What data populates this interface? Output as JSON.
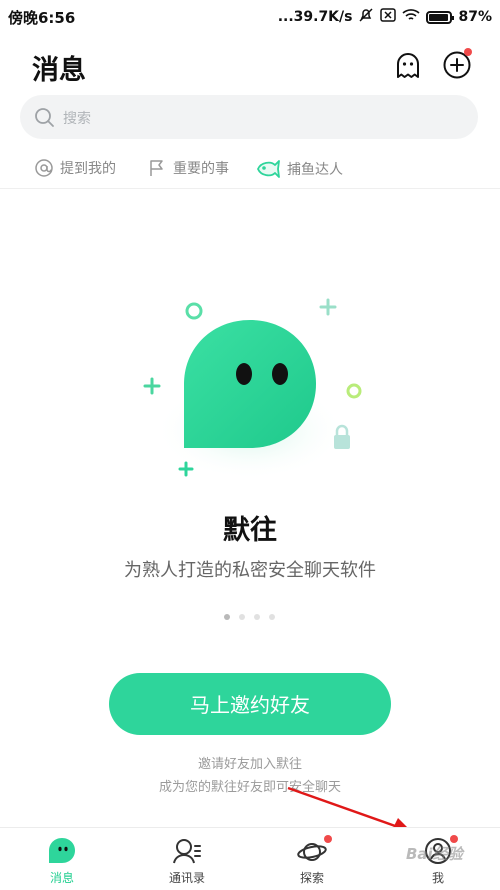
{
  "status_bar": {
    "time": "傍晚6:56",
    "network_speed": "...39.7K/s",
    "battery_percent": "87%"
  },
  "header": {
    "title": "消息"
  },
  "search": {
    "placeholder": "搜索"
  },
  "filters": [
    {
      "label": "提到我的",
      "icon": "at-icon"
    },
    {
      "label": "重要的事",
      "icon": "flag-icon"
    },
    {
      "label": "捕鱼达人",
      "icon": "fish-icon"
    }
  ],
  "empty_state": {
    "app_name": "默往",
    "slogan": "为熟人打造的私密安全聊天软件",
    "carousel_pages": 4,
    "carousel_active": 1,
    "invite_button": "马上邀约好友",
    "invite_note_line1": "邀请好友加入默往",
    "invite_note_line2": "成为您的默往好友即可安全聊天"
  },
  "tabs": [
    {
      "label": "消息",
      "icon": "chat-bubble-icon",
      "active": true
    },
    {
      "label": "通讯录",
      "icon": "contacts-icon",
      "active": false
    },
    {
      "label": "探索",
      "icon": "planet-icon",
      "active": false,
      "badge": true
    },
    {
      "label": "我",
      "icon": "profile-icon",
      "active": false,
      "badge": true
    }
  ],
  "watermark": "Bai经验",
  "colors": {
    "accent": "#2ed59b",
    "badge": "#f04a4a"
  }
}
